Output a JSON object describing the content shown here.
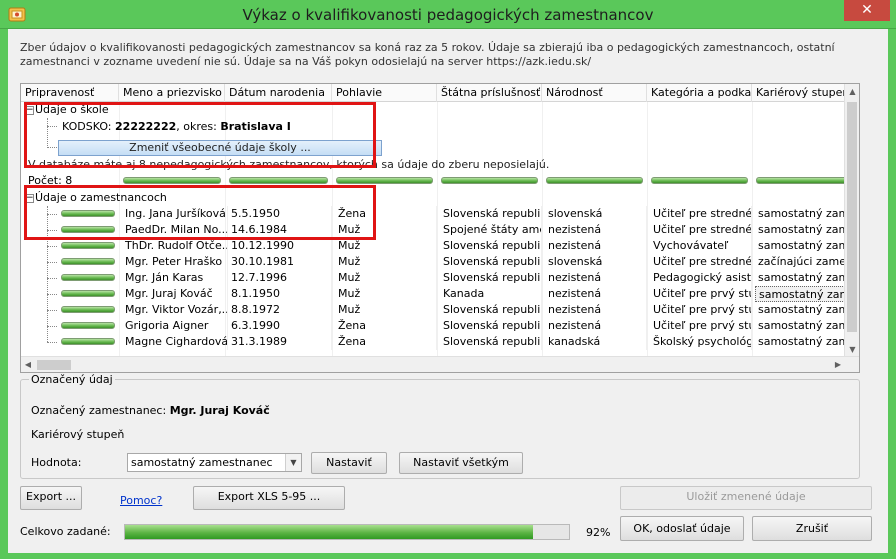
{
  "window": {
    "title": "Výkaz o kvalifikovanosti pedagogických zamestnancov",
    "close_glyph": "✕"
  },
  "intro": "Zber údajov o kvalifikovanosti pedagogických zamestnancov sa koná raz za 5 rokov. Údaje sa zbierajú iba o pedagogických zamestnancoch, ostatní zamestnanci v zozname uvedení nie sú. Údaje sa na Váš pokyn odosielajú na server https://azk.iedu.sk/",
  "columns": [
    "Pripravenosť",
    "Meno a priezvisko",
    "Dátum narodenia",
    "Pohlavie",
    "Štátna príslušnosť",
    "Národnosť",
    "Kategória a podka...",
    "Kariérový stupeň"
  ],
  "school": {
    "group_label": "Údaje o škole",
    "kodsko_label": "KODSKO: ",
    "kodsko_value": "22222222",
    "okres_label": ", okres: ",
    "okres_value": "Bratislava I",
    "change_button": "Zmeniť všeobecné údaje školy ..."
  },
  "notice": "V databáze máte aj 8 nepedagogických zamestnancov, ktorých sa údaje do zberu neposielajú.",
  "count_label": "Počet: 8",
  "employees_group_label": "Údaje o zamestnancoch",
  "employees": [
    {
      "name": "Ing. Jana Juršíková",
      "dob": "5.5.1950",
      "sex": "Žena",
      "citizenship": "Slovenská republi...",
      "nationality": "slovenská",
      "category": "Učiteľ pre stredné...",
      "career": "samostatný zames..."
    },
    {
      "name": "PaedDr. Milan No...",
      "dob": "14.6.1984",
      "sex": "Muž",
      "citizenship": "Spojené štáty ame...",
      "nationality": "nezistená",
      "category": "Učiteľ pre stredné...",
      "career": "samostatný zames..."
    },
    {
      "name": "ThDr. Rudolf Otče...",
      "dob": "10.12.1990",
      "sex": "Muž",
      "citizenship": "Slovenská republi...",
      "nationality": "nezistená",
      "category": "Vychovávateľ",
      "career": "samostatný zames..."
    },
    {
      "name": "Mgr. Peter Hraško",
      "dob": "30.10.1981",
      "sex": "Muž",
      "citizenship": "Slovenská republi...",
      "nationality": "slovenská",
      "category": "Učiteľ pre stredné...",
      "career": "začínajúci zamest..."
    },
    {
      "name": "Mgr. Ján Karas",
      "dob": "12.7.1996",
      "sex": "Muž",
      "citizenship": "Slovenská republi...",
      "nationality": "nezistená",
      "category": "Pedagogický asist...",
      "career": "samostatný zames..."
    },
    {
      "name": "Mgr. Juraj Kováč",
      "dob": "8.1.1950",
      "sex": "Muž",
      "citizenship": "Kanada",
      "nationality": "nezistená",
      "category": "Učiteľ pre prvý stu...",
      "career": "samostatný zames..."
    },
    {
      "name": "Mgr. Viktor Vozár,...",
      "dob": "8.8.1972",
      "sex": "Muž",
      "citizenship": "Slovenská republi...",
      "nationality": "nezistená",
      "category": "Učiteľ pre prvý stu...",
      "career": "samostatný zames..."
    },
    {
      "name": "Grigoria Aigner",
      "dob": "6.3.1990",
      "sex": "Žena",
      "citizenship": "Slovenská republi...",
      "nationality": "nezistená",
      "category": "Učiteľ pre prvý stu...",
      "career": "samostatný zames..."
    },
    {
      "name": "Magne Cighardová",
      "dob": "31.3.1989",
      "sex": "Žena",
      "citizenship": "Slovenská republi...",
      "nationality": "kanadská",
      "category": "Školský psychológ",
      "career": "samostatný zames..."
    }
  ],
  "selected": {
    "group_title": "Označený údaj",
    "employee_label": "Označený zamestnanec: ",
    "employee_value": "Mgr. Juraj Kováč",
    "field_label": "Kariérový stupeň",
    "value_label": "Hodnota:",
    "value": "samostatný zamestnanec",
    "set_button": "Nastaviť",
    "set_all_button": "Nastaviť všetkým"
  },
  "footer": {
    "export_button": "Export ...",
    "help_link": "Pomoc?",
    "export_xls_button": "Export XLS 5-95 ...",
    "save_button": "Uložiť zmenené údaje",
    "total_label": "Celkovo zadané:",
    "progress_percent": 92,
    "progress_text": "92%",
    "ok_button": "OK, odoslať údaje",
    "cancel_button": "Zrušiť"
  },
  "colors": {
    "titlebar": "#5ac85a",
    "close": "#c74a3f",
    "highlight_box": "#e01414",
    "link": "#0033cc"
  }
}
